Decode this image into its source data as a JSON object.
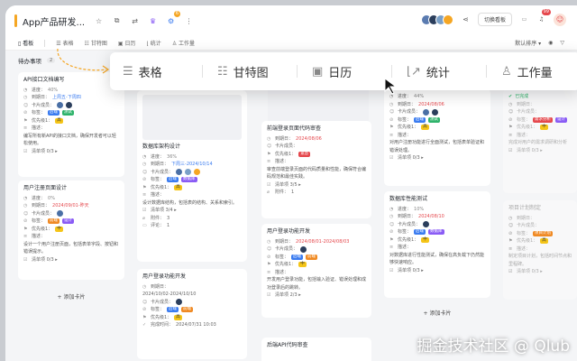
{
  "app": {
    "title": "App产品研发...",
    "top_badge": "6"
  },
  "topbar": {
    "switch_board": "切换看板",
    "notif_count": "99"
  },
  "tabs": {
    "items": [
      "看板",
      "表格",
      "甘特图",
      "日历",
      "统计",
      "工作量"
    ],
    "sort": "默认排序"
  },
  "sticky_tabs": [
    "表格",
    "甘特图",
    "日历",
    "统计",
    "工作量"
  ],
  "col1": {
    "title": "待办事项",
    "count": "2",
    "cards": [
      {
        "title": "API接口文档编写",
        "progress": "进度：",
        "progress_val": "40%",
        "date_label": "到期日：",
        "date": "上周五-下周四",
        "members": "卡片成员：",
        "tags_label": "标签：",
        "tags": [
          "后端",
          "测试"
        ],
        "priority_label": "优先级1：",
        "priority": "高",
        "desc_label": "描述：",
        "desc": "编写所有新API的接口文档，确保开发者可以轻松使用。",
        "checklist": "清单项 0/3 ▸"
      },
      {
        "title": "用户注册页面设计",
        "progress": "进度：",
        "progress_val": "0%",
        "date_label": "到期日：",
        "date": "2024/09/01-昨天",
        "members": "卡片成员：",
        "tags_label": "标签：",
        "tags": [
          "前端",
          "设计"
        ],
        "priority_label": "优先级1：",
        "priority": "中",
        "desc_label": "描述：",
        "desc": "设计一个用户注册页面，包括表单字段、按钮和错误提示。",
        "checklist": "清单项 0/3 ▸"
      }
    ],
    "add": "+ 添加卡片"
  },
  "col2": {
    "cards": [
      {
        "title": "数据库架构设计",
        "progress": "进度：",
        "progress_val": "36%",
        "date_label": "到期日：",
        "date": "下周三-2024/10/14",
        "members": "卡片成员：",
        "tags_label": "标签：",
        "tags": [
          "后端",
          "数据库"
        ],
        "priority_label": "优先级1：",
        "priority": "高",
        "desc_label": "描述：",
        "desc": "设计数据库结构，包括表的结构、关系和索引。",
        "checklist": "清单项 3/4 ▸",
        "attach": "附件：",
        "attach_val": "3",
        "comments": "评论：",
        "comments_val": "1"
      },
      {
        "title": "用户登录功能开发",
        "date_label": "到期日：",
        "date": "2024/10/02-2024/10/10",
        "members": "卡片成员：",
        "tags_label": "标签：",
        "tags": [
          "后端",
          "前端"
        ],
        "priority_label": "优先级1：",
        "priority": "高",
        "done_label": "完成时间：",
        "done": "2024/07/31 10:03"
      }
    ]
  },
  "col3": {
    "cards": [
      {
        "title": "前端登录页面代码审查",
        "date_label": "到期日：",
        "date": "2024/08/06",
        "members": "卡片成员：",
        "priority_label": "优先级1：",
        "priority": "紧急",
        "desc_label": "描述：",
        "desc": "审查前端登录页面的代码质量和性能，确保符合编码规范和最佳实践。",
        "checklist": "清单项 3/5 ▸",
        "attach": "附件：",
        "attach_val": "1"
      },
      {
        "title": "用户登录功能开发",
        "date_label": "到期日：",
        "date": "2024/08/01-2024/08/03",
        "members": "卡片成员：",
        "tags_label": "标签：",
        "tags": [
          "后端",
          "前端"
        ],
        "priority_label": "优先级1：",
        "priority": "中",
        "desc_label": "描述：",
        "desc": "开发用户登录功能，包括输入验证、错误处理和成功登录后的跳转。",
        "checklist": "清单项 2/3 ▸"
      },
      {
        "title": "后端API代码审查"
      }
    ]
  },
  "col4": {
    "cards": [
      {
        "progress": "进度：",
        "progress_val": "44%",
        "date_label": "到期日：",
        "date": "2024/08/06",
        "members": "卡片成员：",
        "tags_label": "标签：",
        "tags": [
          "后端",
          "测试"
        ],
        "priority_label": "优先级1：",
        "priority": "高",
        "desc_label": "描述：",
        "desc": "对用户注册功能进行全面测试，包括表单验证和错误处理。",
        "checklist": "清单项 0/3 ▸"
      },
      {
        "title": "数据库性能测试",
        "progress": "进度：",
        "progress_val": "10%",
        "date_label": "到期日：",
        "date": "2024/08/10",
        "members": "卡片成员：",
        "tags_label": "标签：",
        "tags": [
          "后端",
          "数据库"
        ],
        "priority_label": "优先级1：",
        "priority": "中",
        "desc_label": "描述：",
        "desc": "对数据库进行性能测试，确保在高负载下仍然能够快速响应。",
        "checklist": "清单项 0/3 ▸"
      }
    ],
    "add": "+ 添加卡片"
  },
  "col5": {
    "status": "已完成",
    "cards": [
      {
        "date_label": "到期日：",
        "members": "卡片成员：",
        "tags_label": "标签：",
        "tags": [
          "需求分析",
          "设计"
        ],
        "priority_label": "优先级1：",
        "priority": "中",
        "desc_label": "描述：",
        "desc": "完成对用户的需求调研和分析",
        "checklist": "清单项 0/3 ▸"
      },
      {
        "title": "项目计划制定",
        "date_label": "到期日：",
        "members": "卡片成员：",
        "tags_label": "标签：",
        "tags": [
          "项目计划"
        ],
        "priority_label": "优先级1：",
        "priority": "高",
        "desc_label": "描述：",
        "desc": "制定项目计划，包括时间节点和里程碑。",
        "checklist": "清单项 0/3 ▸"
      }
    ]
  },
  "watermark": "掘金技术社区 @ Qlub"
}
